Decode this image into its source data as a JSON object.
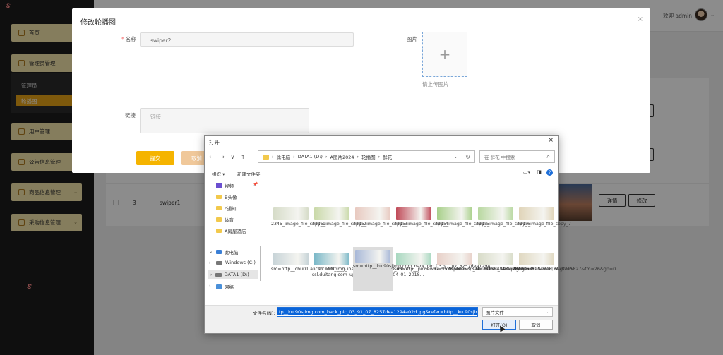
{
  "sidebar": {
    "items": [
      {
        "label": "首页"
      },
      {
        "label": "管理员管理"
      },
      {
        "label": "用户管理"
      },
      {
        "label": "公告信息管理"
      },
      {
        "label": "商品信息管理"
      },
      {
        "label": "采购信息管理"
      }
    ],
    "submenu": {
      "item1": "管理员",
      "item2": "轮播图"
    }
  },
  "topbar": {
    "welcome": "欢迎 admin"
  },
  "table": {
    "row3": {
      "index": "3",
      "name": "swiper1",
      "detail": "详情",
      "edit": "修改"
    }
  },
  "modal": {
    "title": "修改轮播图",
    "close": "×",
    "name_label": "名称",
    "name_value": "swiper2",
    "image_label": "图片",
    "upload_plus": "+",
    "upload_tip": "请上传图片",
    "link_label": "链接",
    "link_placeholder": "链接",
    "submit": "提交",
    "cancel": "取消"
  },
  "file_dialog": {
    "title": "打开",
    "close": "×",
    "nav": "← → ∨ ↑",
    "path": [
      "此电脑",
      "DATA1 (D:)",
      "A图片2024",
      "轮播图",
      "鲜花"
    ],
    "search_placeholder": "在 鲜花 中搜索",
    "organize": "组织 ▾",
    "new_folder": "新建文件夹",
    "tree": [
      {
        "label": "视频"
      },
      {
        "label": "B头像"
      },
      {
        "label": "c通知"
      },
      {
        "label": "体育"
      },
      {
        "label": "A房屋酒店"
      },
      {
        "label": "此电脑"
      },
      {
        "label": "Windows (C:)"
      },
      {
        "label": "DATA1 (D:)"
      },
      {
        "label": "网络"
      }
    ],
    "files": [
      {
        "name": "2345_image_file_copy_1",
        "color": "#d6dcc8"
      },
      {
        "name": "2345_image_file_copy_2",
        "color": "#c9d9a8"
      },
      {
        "name": "2345_image_file_copy_3",
        "color": "#e8c9c0"
      },
      {
        "name": "2345_image_file_copy_4",
        "color": "#c04a58"
      },
      {
        "name": "2345_image_file_copy_5",
        "color": "#a8d08a"
      },
      {
        "name": "2345_image_file_copy_6",
        "color": "#b8d8a0"
      },
      {
        "name": "2345_image_file_copy_7",
        "color": "#e0d4b8"
      },
      {
        "name": "src=http__cbu01.alicdn.com_img_ibank_2017_168_813_48573...",
        "color": "#c8d4d8"
      },
      {
        "name": "src=http__c-ssl.duitang.com_uploads_item_201804_01_2018...",
        "color": "#7ab8c8"
      },
      {
        "name": "src=http__ku.90sjimg.com_back_pic_03_91_07_8257dea1294...",
        "color": "#a8b8d8"
      },
      {
        "name": "src=http__picnew12.photophoto.cn_20180621_xiaoqingxinw...",
        "color": "#a8d8c0"
      },
      {
        "name": "u=1578240953,3243381594&fm=26&gp=0",
        "color": "#e8d0c8"
      },
      {
        "name": "u=2047823439,984945750&fm=15&gp=0",
        "color": "#d8dcc8"
      },
      {
        "name": "u=3638204948,2428215827&fm=26&gp=0",
        "color": "#e0d8c0"
      }
    ],
    "filename_label": "文件名(N):",
    "filename_value": "tp__ku.90sjimg.com_back_pic_03_91_07_8257dea1294a02d.jpg&refer=http__ku.90sjimg",
    "filetype": "图片文件",
    "open": "打开(O)",
    "cancel": "取消"
  }
}
